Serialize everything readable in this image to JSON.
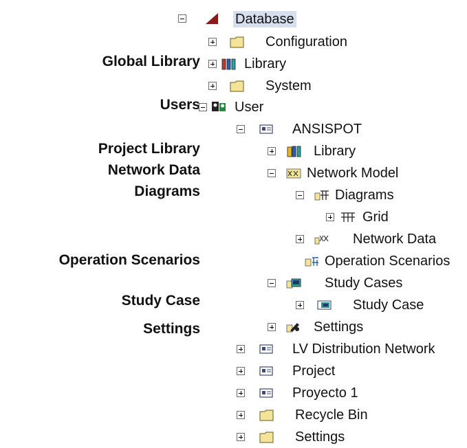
{
  "annotations": {
    "global_library": "Global Library",
    "users": "Users",
    "project_library": "Project Library",
    "network_data": "Network Data",
    "diagrams": "Diagrams",
    "operation_scenarios": "Operation Scenarios",
    "study_case": "Study Case",
    "settings": "Settings"
  },
  "tree": {
    "database": "Database",
    "configuration": "Configuration",
    "library": "Library",
    "system": "System",
    "user": "User",
    "ansispot": "ANSISPOT",
    "project_library": "Library",
    "network_model": "Network Model",
    "diagrams": "Diagrams",
    "grid": "Grid",
    "network_data": "Network Data",
    "operation_scenarios": "Operation Scenarios",
    "study_cases": "Study Cases",
    "study_case": "Study Case",
    "settings": "Settings",
    "lv_distribution_network": "LV Distribution Network",
    "project": "Project",
    "proyecto_1": "Proyecto 1",
    "recycle_bin": "Recycle Bin",
    "settings_root": "Settings"
  }
}
